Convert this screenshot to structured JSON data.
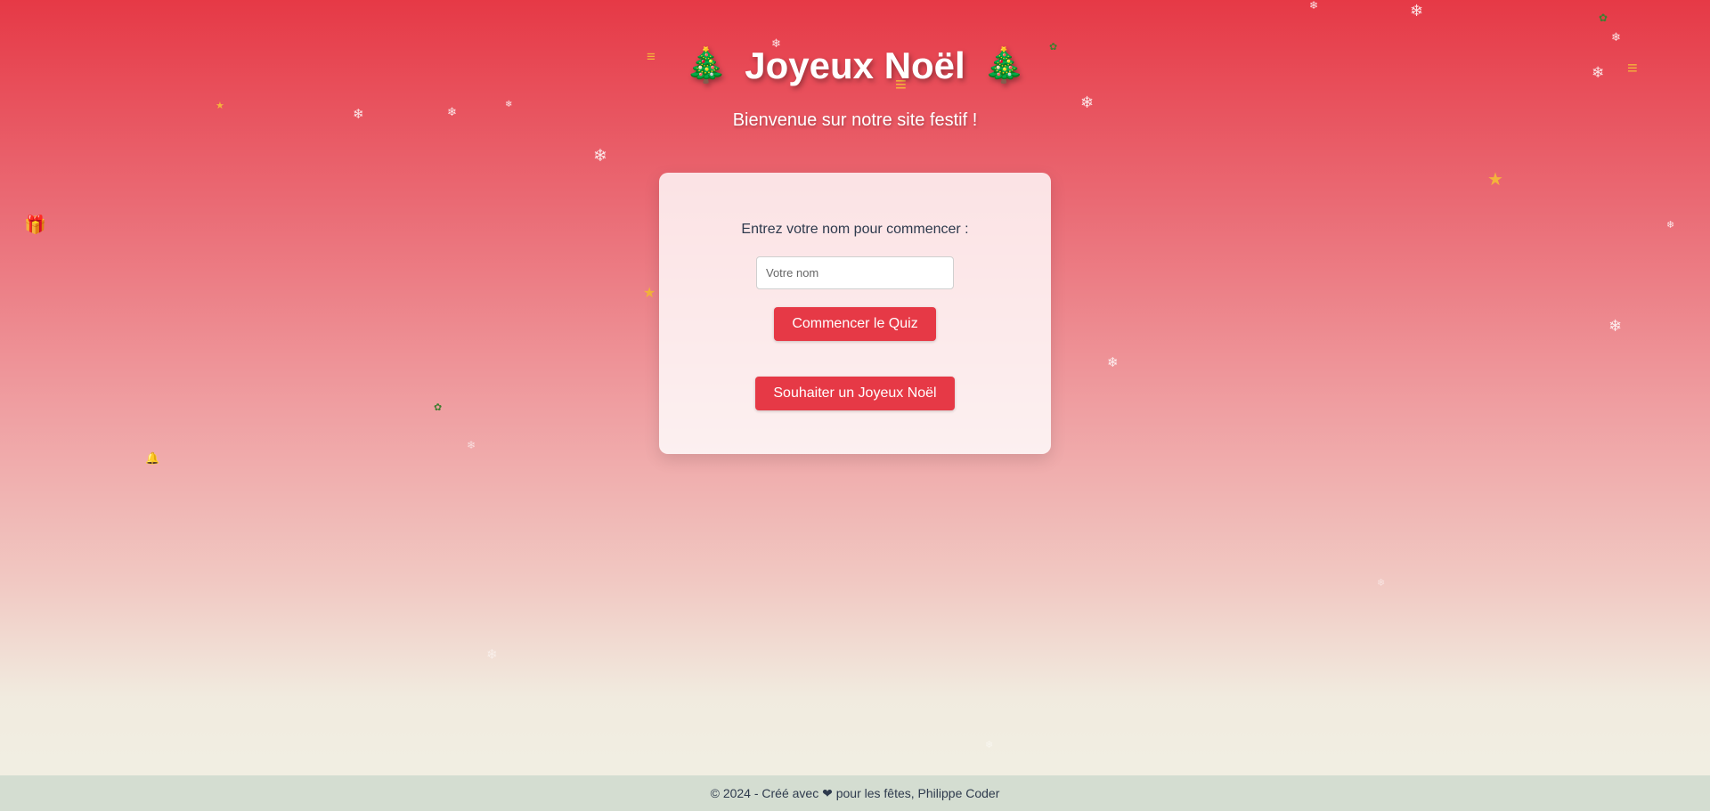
{
  "header": {
    "title": "Joyeux Noël",
    "tree_left": "🎄",
    "tree_right": "🎄",
    "subtitle": "Bienvenue sur notre site festif !"
  },
  "card": {
    "prompt": "Entrez votre nom pour commencer :",
    "name_placeholder": "Votre nom",
    "name_value": "",
    "start_quiz_label": "Commencer le Quiz",
    "wish_label": "Souhaiter un Joyeux Noël"
  },
  "footer": {
    "text": "© 2024 - Créé avec ❤ pour les fêtes, Philippe Coder"
  },
  "decorations": {
    "snowflake": "❄",
    "star": "★",
    "gift": "🎁",
    "holly": "✿",
    "bell": "🔔",
    "scarf": "≡"
  },
  "colors": {
    "accent": "#e63946",
    "footer_bg": "#d4ddd1",
    "text_dark": "#2e3a4d"
  }
}
